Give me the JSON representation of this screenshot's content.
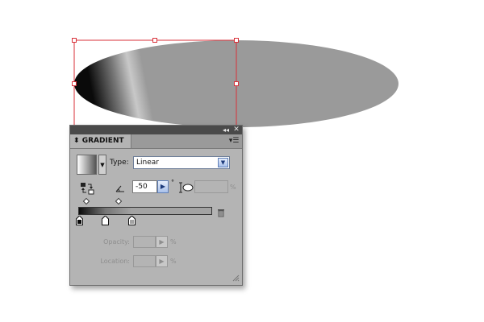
{
  "panel": {
    "collapse_icon": "◂◂",
    "close_icon": "✕",
    "tab_label": "GRADIENT",
    "tab_arrows": "⬍",
    "menu_icon": "▾☰",
    "swatch_dropdown_icon": "▼",
    "type_label": "Type:",
    "type_value": "Linear",
    "type_arrow_icon": "▼",
    "angle_value": "-50",
    "angle_button_icon": "▶",
    "degree_symbol": "°",
    "aspect_percent": "%",
    "opacity_label": "Opacity:",
    "location_label": "Location:",
    "stepper_icon": "▶",
    "percent": "%"
  },
  "colors": {
    "selection": "#d8313a",
    "panel_bg": "#b4b4b4",
    "titlebar": "#4a4a4a",
    "accent_button": "#a9c0ea"
  },
  "gradient": {
    "type": "Linear",
    "angle_degrees": -50,
    "stops": [
      "#0a0a0a",
      "#767676",
      "#a3a3a3"
    ],
    "selected_stop": 0
  }
}
